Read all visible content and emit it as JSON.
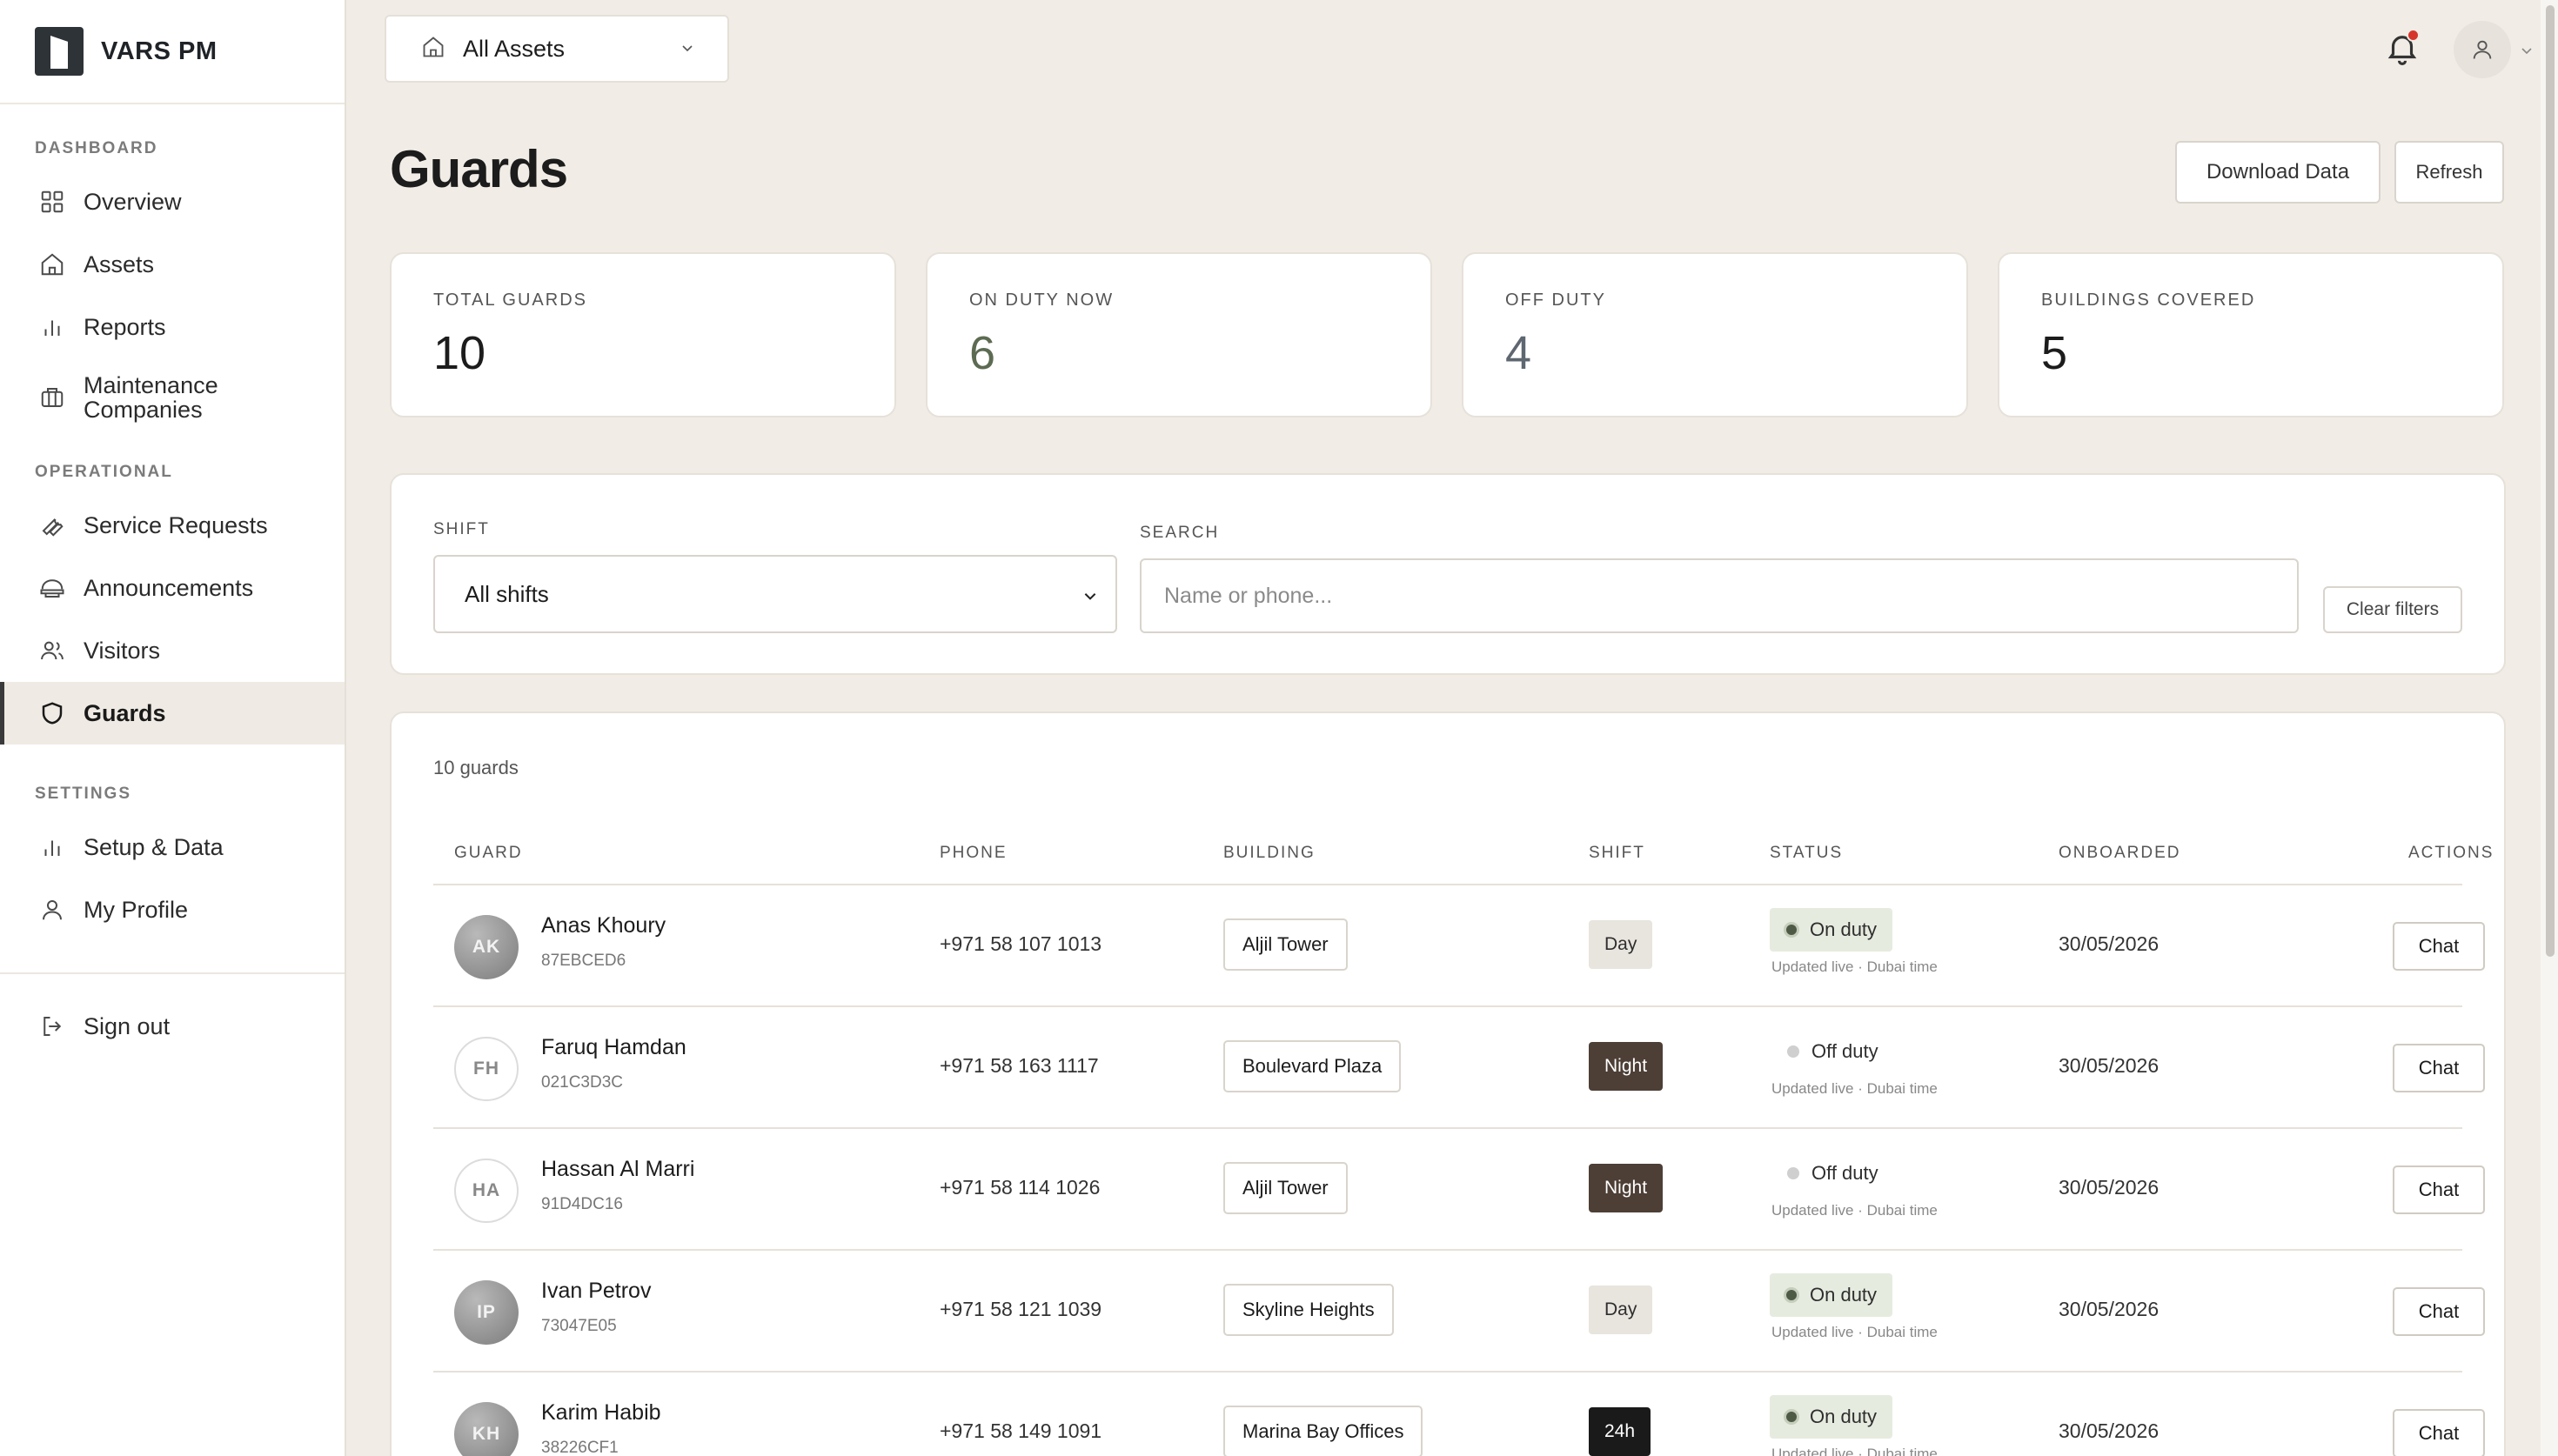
{
  "app": {
    "name": "VARS PM"
  },
  "sidebar": {
    "sections": [
      {
        "heading": "DASHBOARD",
        "items": [
          {
            "label": "Overview",
            "icon": "grid-icon"
          },
          {
            "label": "Assets",
            "icon": "home-icon"
          },
          {
            "label": "Reports",
            "icon": "bar-chart-icon"
          },
          {
            "label": "Maintenance Companies",
            "icon": "briefcase-icon"
          }
        ]
      },
      {
        "heading": "OPERATIONAL",
        "items": [
          {
            "label": "Service Requests",
            "icon": "wrench-icon"
          },
          {
            "label": "Announcements",
            "icon": "megaphone-icon"
          },
          {
            "label": "Visitors",
            "icon": "users-icon"
          },
          {
            "label": "Guards",
            "icon": "shield-icon",
            "active": true
          }
        ]
      },
      {
        "heading": "SETTINGS",
        "items": [
          {
            "label": "Setup & Data",
            "icon": "bar-chart-icon"
          },
          {
            "label": "My Profile",
            "icon": "user-icon"
          }
        ]
      }
    ],
    "signout": "Sign out"
  },
  "topbar": {
    "asset_selector": "All Assets",
    "notifications": true
  },
  "header": {
    "title": "Guards",
    "download": "Download Data",
    "refresh": "Refresh"
  },
  "stats": [
    {
      "label": "TOTAL GUARDS",
      "value": "10"
    },
    {
      "label": "ON DUTY NOW",
      "value": "6"
    },
    {
      "label": "OFF DUTY",
      "value": "4"
    },
    {
      "label": "BUILDINGS COVERED",
      "value": "5"
    }
  ],
  "filters": {
    "shift_label": "SHIFT",
    "shift_value": "All shifts",
    "search_label": "SEARCH",
    "search_placeholder": "Name or phone...",
    "clear": "Clear filters"
  },
  "table": {
    "count": "10 guards",
    "columns": [
      "GUARD",
      "PHONE",
      "BUILDING",
      "SHIFT",
      "STATUS",
      "ONBOARDED",
      "ACTIONS"
    ],
    "status_note": "Updated live · Dubai time",
    "action": "Chat",
    "rows": [
      {
        "initials": "AK",
        "name": "Anas Khoury",
        "id": "87EBCED6",
        "phone": "+971 58 107 1013",
        "building": "Aljil Tower",
        "shift": "Day",
        "status": "On duty",
        "onboarded": "30/05/2026"
      },
      {
        "initials": "FH",
        "name": "Faruq Hamdan",
        "id": "021C3D3C",
        "phone": "+971 58 163 1117",
        "building": "Boulevard Plaza",
        "shift": "Night",
        "status": "Off duty",
        "onboarded": "30/05/2026"
      },
      {
        "initials": "HA",
        "name": "Hassan Al Marri",
        "id": "91D4DC16",
        "phone": "+971 58 114 1026",
        "building": "Aljil Tower",
        "shift": "Night",
        "status": "Off duty",
        "onboarded": "30/05/2026"
      },
      {
        "initials": "IP",
        "name": "Ivan Petrov",
        "id": "73047E05",
        "phone": "+971 58 121 1039",
        "building": "Skyline Heights",
        "shift": "Day",
        "status": "On duty",
        "onboarded": "30/05/2026"
      },
      {
        "initials": "KH",
        "name": "Karim Habib",
        "id": "38226CF1",
        "phone": "+971 58 149 1091",
        "building": "Marina Bay Offices",
        "shift": "24h",
        "status": "On duty",
        "onboarded": "30/05/2026"
      }
    ]
  }
}
